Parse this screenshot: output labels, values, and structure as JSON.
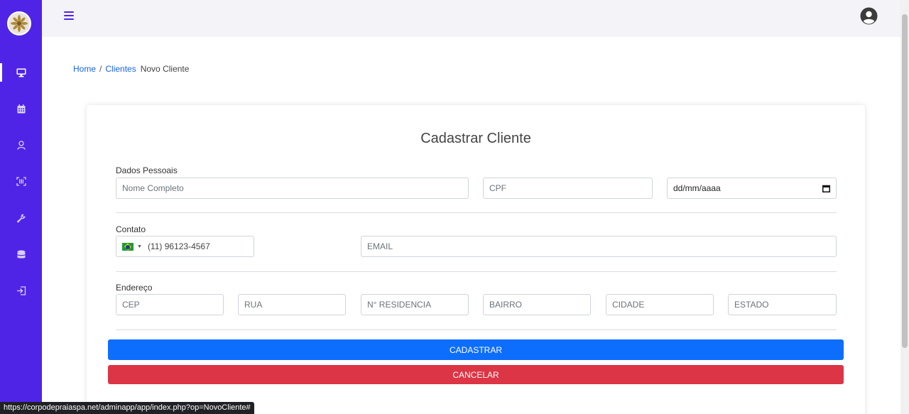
{
  "breadcrumb": {
    "home": "Home",
    "sep": "/",
    "clientes": "Clientes",
    "current": "Novo Cliente"
  },
  "form": {
    "title": "Cadastrar Cliente",
    "sections": {
      "personal": "Dados Pessoais",
      "contact": "Contato",
      "address": "Endereço"
    },
    "placeholders": {
      "nome": "Nome Completo",
      "cpf": "CPF",
      "email": "EMAIL",
      "cep": "CEP",
      "rua": "RUA",
      "residencia": "N° RESIDENCIA",
      "bairro": "BAIRRO",
      "cidade": "CIDADE",
      "estado": "ESTADO"
    },
    "date_value": "dd/mm/aaaa",
    "phone_value": "(11) 96123-4567",
    "buttons": {
      "submit": "CADASTRAR",
      "cancel": "CANCELAR"
    }
  },
  "sidebar": {
    "items": [
      {
        "icon": "desktop-icon",
        "active": true
      },
      {
        "icon": "calendar-icon"
      },
      {
        "icon": "user-icon"
      },
      {
        "icon": "scan-icon"
      },
      {
        "icon": "wrench-icon"
      },
      {
        "icon": "database-icon"
      },
      {
        "icon": "sign-out-icon"
      }
    ]
  },
  "status_url": "https://corpodepraiaspa.net/adminapp/app/index.php?op=NovoCliente#",
  "colors": {
    "sidebar": "#5024e6",
    "primary": "#0d6efd",
    "danger": "#dc3545",
    "link": "#1a63e8"
  }
}
